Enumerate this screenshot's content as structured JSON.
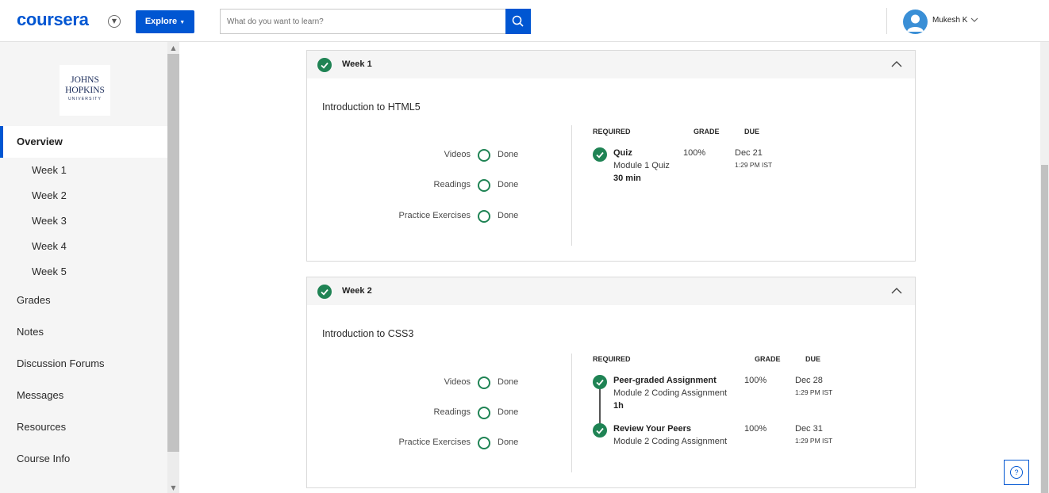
{
  "header": {
    "logo": "coursera",
    "explore_label": "Explore",
    "search_placeholder": "What do you want to learn?",
    "user_name": "Mukesh K"
  },
  "sidebar": {
    "university_logo": {
      "line1": "JOHNS",
      "line2": "HOPKINS",
      "line3": "UNIVERSITY"
    },
    "overview": "Overview",
    "weeks": [
      "Week 1",
      "Week 2",
      "Week 3",
      "Week 4",
      "Week 5"
    ],
    "links": [
      "Grades",
      "Notes",
      "Discussion Forums",
      "Messages",
      "Resources",
      "Course Info"
    ]
  },
  "week1": {
    "title": "Week 1",
    "lesson": "Introduction to HTML5",
    "stats": [
      {
        "label": "Videos",
        "value": "Done"
      },
      {
        "label": "Readings",
        "value": "Done"
      },
      {
        "label": "Practice Exercises",
        "value": "Done"
      }
    ],
    "headers": {
      "required": "REQUIRED",
      "grade": "GRADE",
      "due": "DUE"
    },
    "items": [
      {
        "type": "Quiz",
        "name": "Module 1 Quiz",
        "duration": "30 min",
        "grade": "100%",
        "due_date": "Dec 21",
        "due_time": "1:29 PM IST"
      }
    ]
  },
  "week2": {
    "title": "Week 2",
    "lesson": "Introduction to CSS3",
    "stats": [
      {
        "label": "Videos",
        "value": "Done"
      },
      {
        "label": "Readings",
        "value": "Done"
      },
      {
        "label": "Practice Exercises",
        "value": "Done"
      }
    ],
    "headers": {
      "required": "REQUIRED",
      "grade": "GRADE",
      "due": "DUE"
    },
    "items": [
      {
        "type": "Peer-graded Assignment",
        "name": "Module 2 Coding Assignment",
        "duration": "1h",
        "grade": "100%",
        "due_date": "Dec 28",
        "due_time": "1:29 PM IST"
      },
      {
        "type": "Review Your Peers",
        "name": "Module 2 Coding Assignment",
        "grade": "100%",
        "due_date": "Dec 31",
        "due_time": "1:29 PM IST"
      }
    ]
  },
  "help": {
    "label": "?"
  },
  "colors": {
    "brand": "#0056d2",
    "success": "#1f8354",
    "sidebar_bg": "#f5f5f5"
  }
}
